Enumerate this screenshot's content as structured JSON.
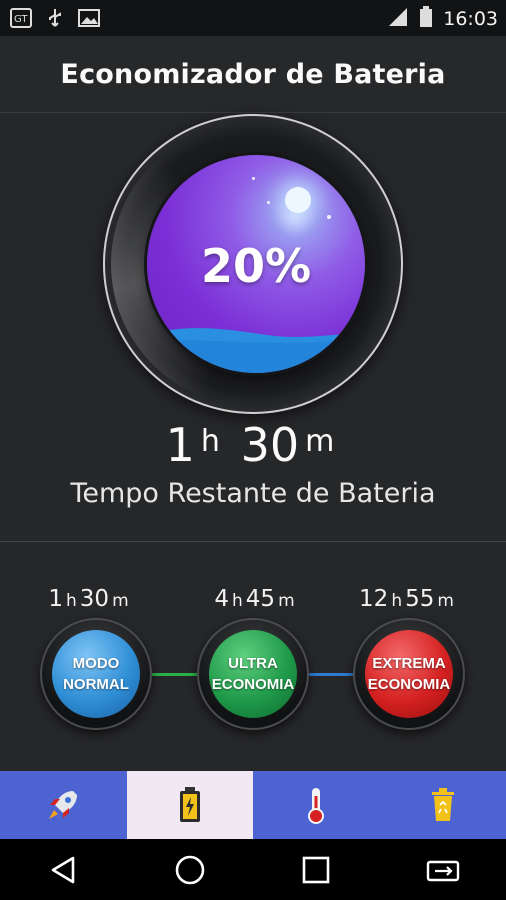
{
  "status_bar": {
    "time": "16:03",
    "left_icons": [
      "translate-notification-icon",
      "usb-icon",
      "image-icon"
    ],
    "right_icons": [
      "signal-icon",
      "battery-icon"
    ]
  },
  "header": {
    "title": "Economizador de Bateria"
  },
  "gauge": {
    "percent_label": "20%",
    "level": 0.2,
    "colors": {
      "orb": "#7b2fd6",
      "water": "#2a8fe0"
    }
  },
  "remaining": {
    "hours": "1",
    "hours_unit": "h",
    "minutes": "30",
    "minutes_unit": "m",
    "label": "Tempo Restante de Bateria"
  },
  "modes": [
    {
      "hours": "1",
      "minutes": "30",
      "line1": "MODO",
      "line2": "NORMAL",
      "color": "#2f8fd6"
    },
    {
      "hours": "4",
      "minutes": "45",
      "line1": "ULTRA",
      "line2": "ECONOMIA",
      "color": "#1f9a4a"
    },
    {
      "hours": "12",
      "minutes": "55",
      "line1": "EXTREMA",
      "line2": "ECONOMIA",
      "color": "#d52121"
    }
  ],
  "units": {
    "h": "h",
    "m": "m"
  },
  "connectors": {
    "left_color": "#2bb34a",
    "right_color": "#2f7bd0"
  },
  "tabs": [
    {
      "icon": "rocket-icon",
      "active": false
    },
    {
      "icon": "battery-charging-icon",
      "active": true
    },
    {
      "icon": "thermometer-icon",
      "active": false
    },
    {
      "icon": "recycle-bin-icon",
      "active": false
    }
  ],
  "nav": [
    "back-icon",
    "home-icon",
    "recents-icon",
    "switch-app-icon"
  ]
}
